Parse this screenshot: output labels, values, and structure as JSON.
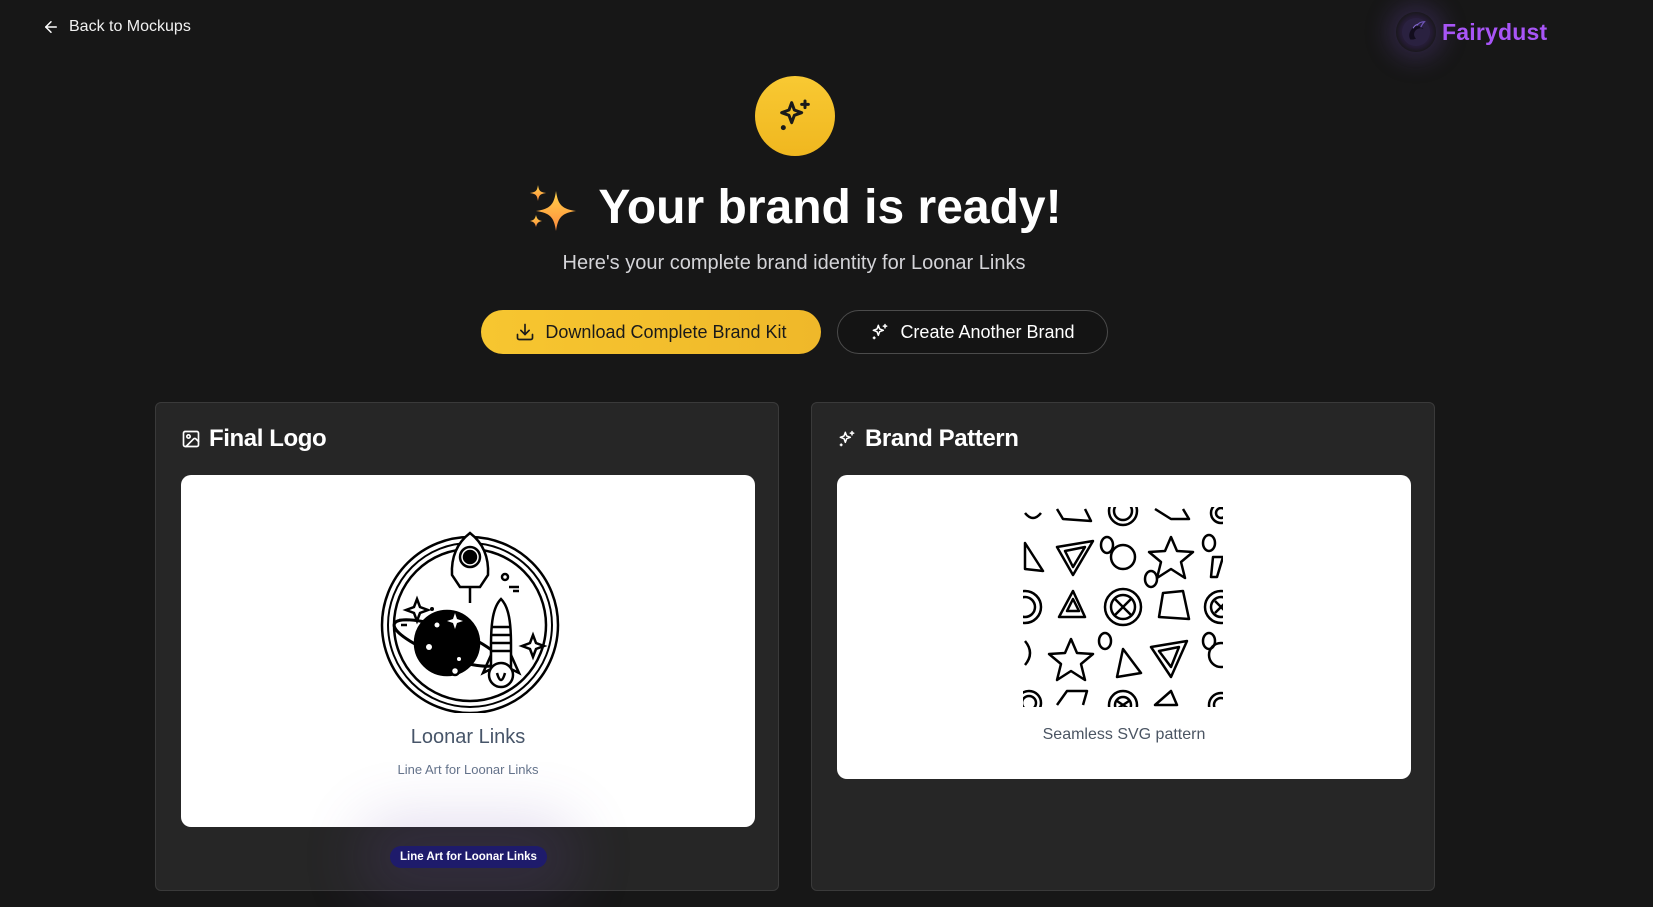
{
  "nav": {
    "back_label": "Back to Mockups",
    "back_icon": "arrow-left-icon"
  },
  "brand": {
    "name": "Fairydust",
    "color": "#a855f7",
    "logo_icon": "fairy-logo-icon"
  },
  "hero": {
    "badge_icon": "sparkles-icon",
    "title": "Your brand is ready!",
    "title_emoji_icon": "sparkles-emoji-icon",
    "subtitle": "Here's your complete brand identity for Loonar Links"
  },
  "actions": {
    "download_label": "Download Complete Brand Kit",
    "download_icon": "download-icon",
    "create_label": "Create Another Brand",
    "create_icon": "sparkles-icon",
    "accent": "#f4c02e"
  },
  "logo_card": {
    "title": "Final Logo",
    "title_icon": "image-icon",
    "logo_name": "Loonar Links",
    "logo_subtitle": "Line Art for Loonar Links",
    "tag": "Line Art for Loonar Links",
    "tag_color": "#1e1b6b"
  },
  "pattern_card": {
    "title": "Brand Pattern",
    "title_icon": "sparkles-icon",
    "caption": "Seamless SVG pattern"
  }
}
